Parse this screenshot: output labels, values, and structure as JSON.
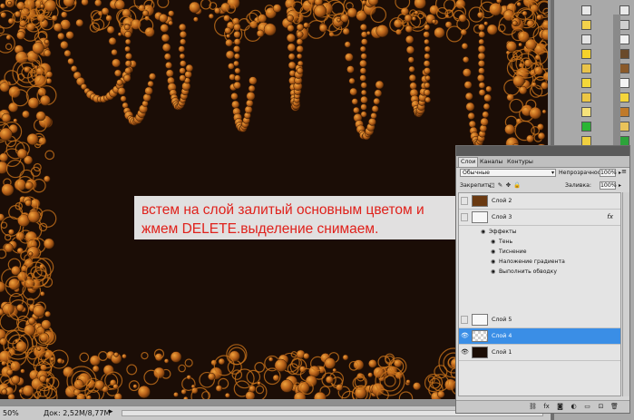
{
  "tooltip": {
    "line1": "встем на слой залитый основным цветом и",
    "line2": "жмем DELETE.выделение снимаем."
  },
  "status": {
    "zoom": "50%",
    "doc": "Док: 2,52M/8,77M"
  },
  "layers_panel": {
    "tabs": [
      "Слои",
      "Каналы",
      "Контуры"
    ],
    "blend_mode": "Обычные",
    "opacity_label": "Непрозрачность:",
    "opacity_value": "100%",
    "lock_label": "Закрепить:",
    "fill_label": "Заливка:",
    "fill_value": "100%",
    "layers": [
      {
        "name": "Слой 2"
      },
      {
        "name": "Слой 3",
        "fx": "fx"
      },
      {
        "name": "Слой 5"
      },
      {
        "name": "Слой 4"
      },
      {
        "name": "Слой 1"
      }
    ],
    "effects_header": "Эффекты",
    "effects": [
      "Тень",
      "Тиснение",
      "Наложение градиента",
      "Выполнить обводку"
    ]
  },
  "colors": {
    "ornament": "#c6701a",
    "canvas_bg": "#1b0d06",
    "selection": "#3a8ee6",
    "tooltip_text": "#e0211b"
  }
}
